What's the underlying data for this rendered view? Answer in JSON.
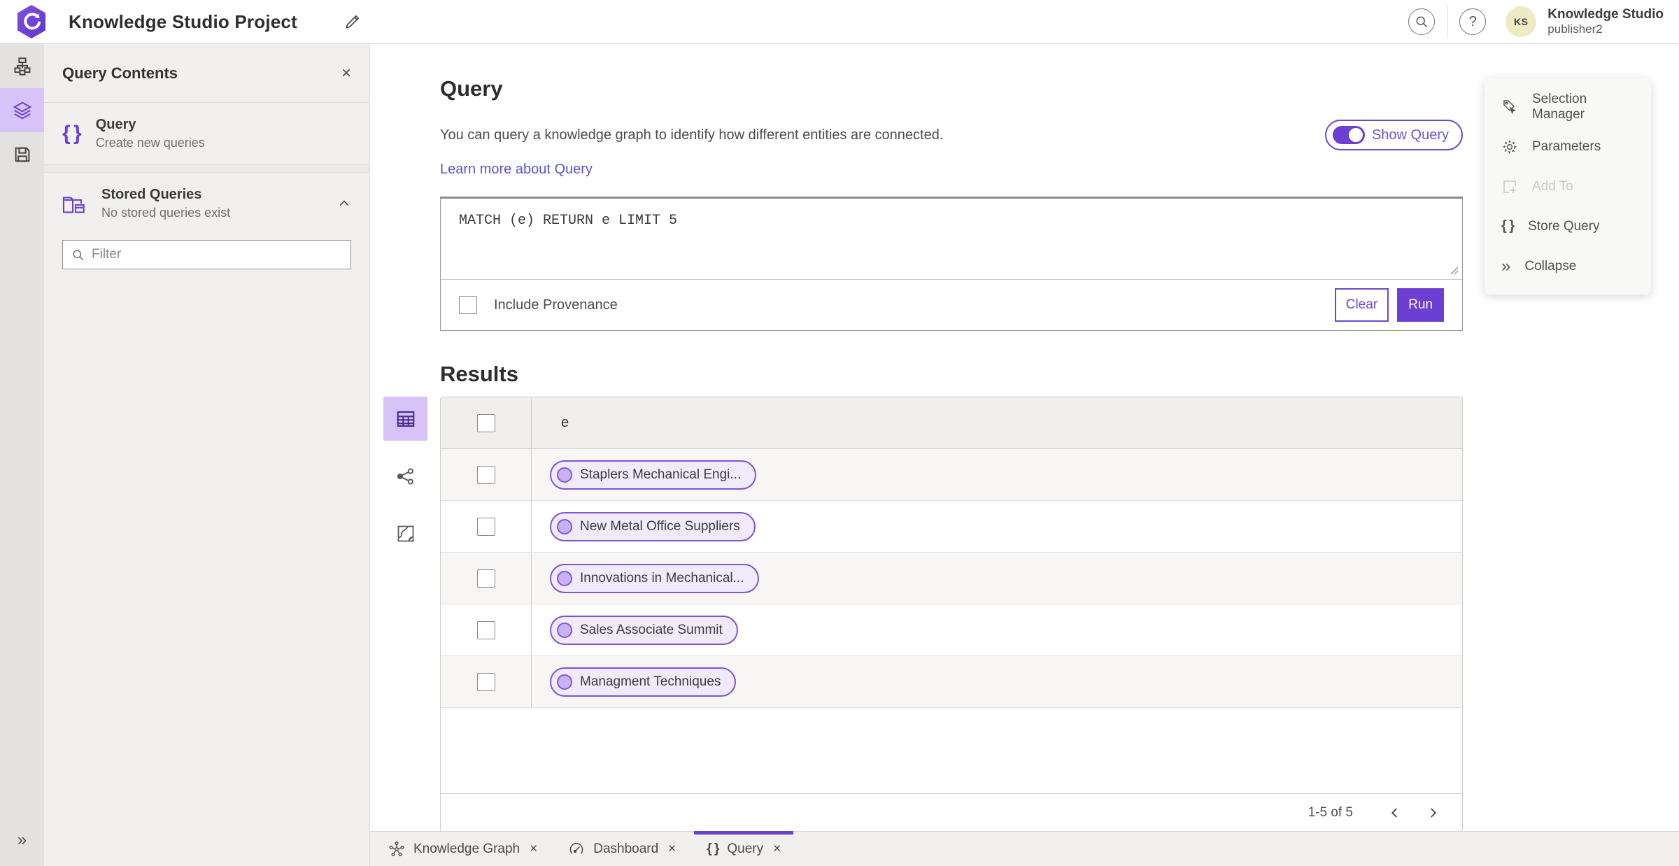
{
  "header": {
    "title": "Knowledge Studio Project",
    "user": {
      "initials": "KS",
      "org": "Knowledge Studio",
      "name": "publisher2"
    }
  },
  "glyphs": {
    "close": "×",
    "help": "?",
    "braces": "{ }",
    "double_chevron_right": "»"
  },
  "panel": {
    "title": "Query Contents",
    "query_item": {
      "label": "Query",
      "description": "Create new queries"
    },
    "stored_item": {
      "label": "Stored Queries",
      "description": "No stored queries exist"
    },
    "filter_placeholder": "Filter"
  },
  "query": {
    "heading": "Query",
    "description": "You can query a knowledge graph to identify how different entities are connected.",
    "learn_more": "Learn more about Query",
    "show_query_label": "Show Query",
    "query_text": "MATCH (e) RETURN e LIMIT 5",
    "include_provenance_label": "Include Provenance",
    "clear_label": "Clear",
    "run_label": "Run"
  },
  "results": {
    "heading": "Results",
    "column_header": "e",
    "rows": [
      {
        "label": "Staplers Mechanical Engi..."
      },
      {
        "label": "New Metal Office Suppliers"
      },
      {
        "label": "Innovations in Mechanical..."
      },
      {
        "label": "Sales Associate Summit"
      },
      {
        "label": "Managment Techniques"
      }
    ],
    "pagination": {
      "label": "1-5 of 5"
    }
  },
  "context_menu": {
    "items": [
      {
        "label": "Selection Manager"
      },
      {
        "label": "Parameters"
      },
      {
        "label": "Add To"
      },
      {
        "label": "Store Query"
      },
      {
        "label": "Collapse"
      }
    ]
  },
  "tabs": [
    {
      "label": "Knowledge Graph"
    },
    {
      "label": "Dashboard"
    },
    {
      "label": "Query"
    }
  ],
  "colors": {
    "accent": "#6b3fd1",
    "accent_light": "#d7c3f8",
    "pill_fill": "#f0eafb",
    "link": "#5a55d2",
    "avatar_bg": "#eeebc4"
  }
}
